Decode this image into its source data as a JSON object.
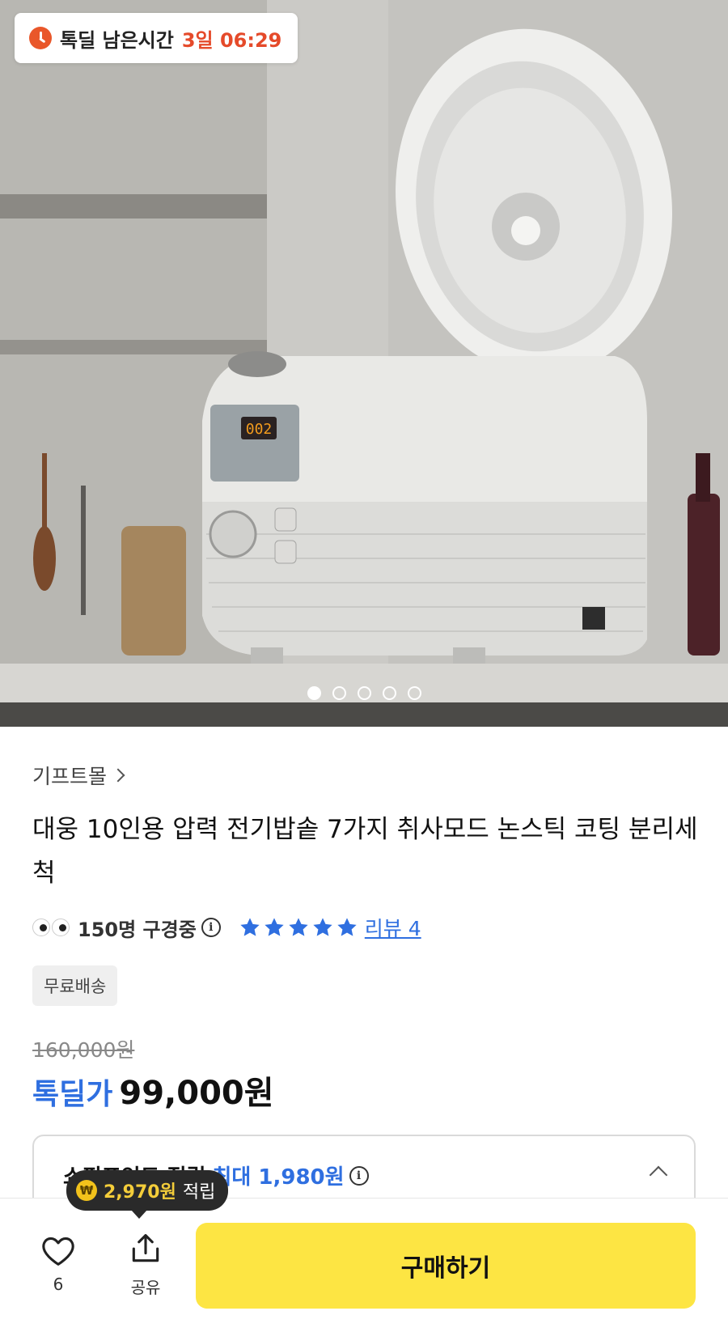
{
  "hero": {
    "timer_label": "톡딜 남은시간",
    "timer_value": "3일 06:29",
    "slide_count": 5,
    "active_slide": 1,
    "image_description_icon": "rice-cooker-photo"
  },
  "product": {
    "seller": "기프트몰",
    "title": "대웅 10인용 압력 전기밥솥 7가지 취사모드 논스틱 코팅 분리세척",
    "viewers": "150명 구경중",
    "rating_stars": 5,
    "review_link": "리뷰 4",
    "shipping_badge": "무료배송",
    "original_price": "160,000원",
    "sale_label": "톡딜가",
    "sale_price": "99,000원"
  },
  "points": {
    "label": "쇼핑포인트 적립",
    "max": "최대 1,980원"
  },
  "tooltip": {
    "coin_symbol": "₩",
    "amount": "2,970원",
    "suffix": "적립"
  },
  "bottom_bar": {
    "like_count": "6",
    "share_label": "공유",
    "buy_label": "구매하기"
  },
  "colors": {
    "accent_blue": "#2f6fe0",
    "timer_red": "#e54a2a",
    "buy_yellow": "#fde543"
  }
}
